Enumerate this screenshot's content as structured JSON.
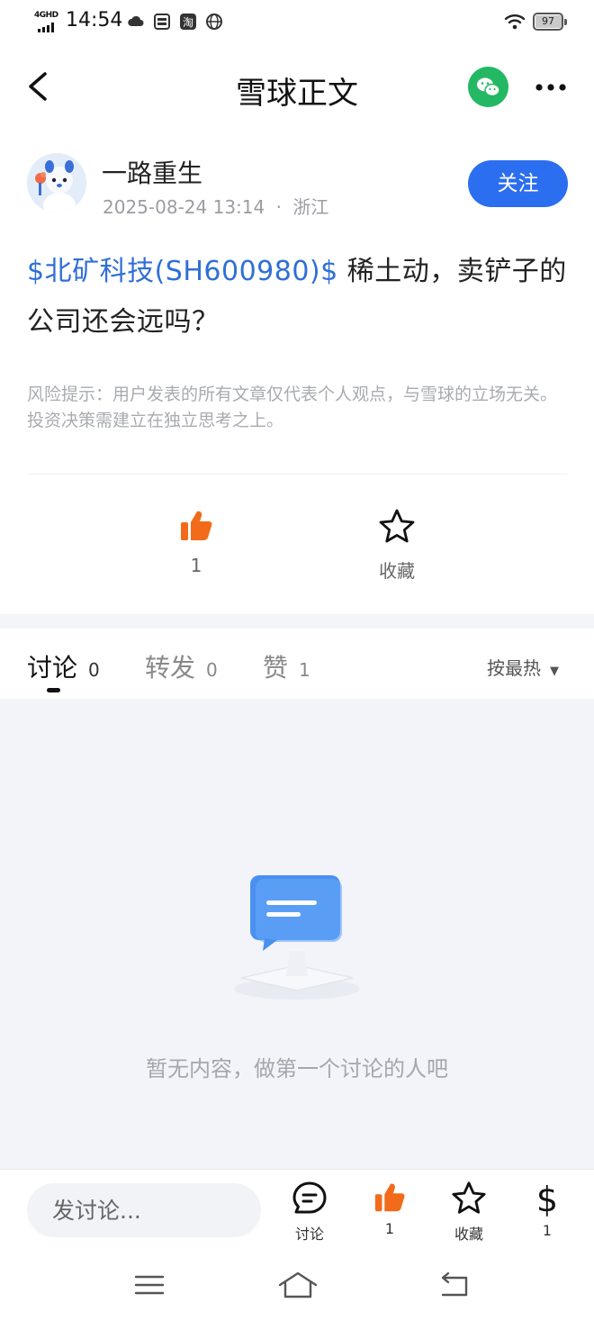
{
  "status_bar": {
    "network": "4GHD",
    "time": "14:54",
    "battery": "97",
    "icons": [
      "cloud-icon",
      "sim-icon",
      "taobao-icon",
      "globe-icon",
      "wifi-icon"
    ]
  },
  "nav": {
    "title": "雪球正文",
    "icons": [
      "back-icon",
      "wechat-icon",
      "more-icon"
    ]
  },
  "author": {
    "name": "一路重生",
    "datetime": "2025-08-24 13:14",
    "separator": "·",
    "location": "浙江",
    "follow_label": "关注"
  },
  "post": {
    "stock_tag": "$北矿科技(SH600980)$",
    "text": " 稀土动，卖铲子的公司还会远吗？",
    "risk_note": "风险提示：用户发表的所有文章仅代表个人观点，与雪球的立场无关。投资决策需建立在独立思考之上。"
  },
  "reactions": {
    "like_count": "1",
    "favorite_label": "收藏"
  },
  "tabs": [
    {
      "label": "讨论",
      "count": "0",
      "active": true
    },
    {
      "label": "转发",
      "count": "0",
      "active": false
    },
    {
      "label": "赞",
      "count": "1",
      "active": false
    }
  ],
  "sort": {
    "label": "按最热"
  },
  "empty_state": {
    "text": "暂无内容，做第一个讨论的人吧"
  },
  "bottom_bar": {
    "input_placeholder": "发讨论...",
    "discuss_label": "讨论",
    "like_count": "1",
    "favorite_label": "收藏",
    "reward_count": "1"
  },
  "colors": {
    "accent_blue": "#2b6ef0",
    "stock_link": "#2f6fd6",
    "like_orange": "#f26b1a",
    "wechat_green": "#25b864",
    "empty_bg": "#f3f4f9"
  }
}
